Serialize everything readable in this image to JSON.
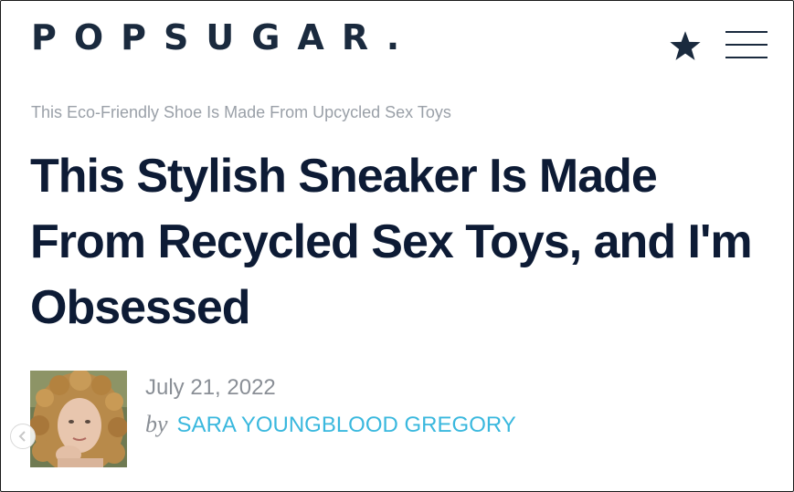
{
  "header": {
    "logo_text": "POPSUGAR.",
    "bookmark_icon": "star-icon",
    "menu_icon": "hamburger-menu-icon"
  },
  "article": {
    "kicker": "This Eco-Friendly Shoe Is Made From Upcycled Sex Toys",
    "headline": "This Stylish Sneaker Is Made From Recycled Sex Toys, and I'm Obsessed",
    "date": "July 21, 2022",
    "by_prefix": "by",
    "author": "SARA YOUNGBLOOD GREGORY"
  },
  "colors": {
    "logo": "#1a2a3e",
    "headline": "#0d1b35",
    "kicker": "#9aa0a8",
    "meta": "#8a8f96",
    "author_link": "#3ab8de"
  }
}
